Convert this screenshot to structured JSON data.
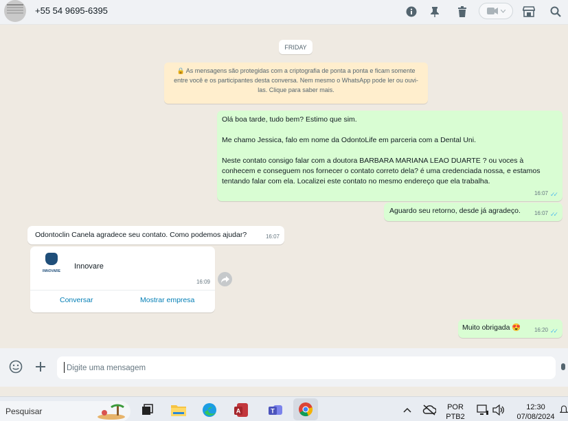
{
  "header": {
    "contact_name": "+55 54 9695-6395"
  },
  "chat": {
    "date_chip": "FRIDAY",
    "encryption_notice": "🔒 As mensagens são protegidas com a criptografia de ponta a ponta e ficam somente entre você e os participantes desta conversa. Nem mesmo o WhatsApp pode ler ou ouvi-las. Clique para saber mais.",
    "messages": [
      {
        "direction": "out",
        "paragraphs": [
          "Olá boa tarde, tudo bem? Estimo que sim.",
          "Me chamo Jessica, falo em nome da OdontoLife em parceria com a Dental Uni.",
          "Neste contato consigo falar com a doutora BARBARA MARIANA LEAO DUARTE ? ou voces à conhecem e conseguem nos fornecer o contato correto dela? é uma credenciada nossa, e estamos tentando falar com ela. Localizei este contato no mesmo endereço que ela trabalha."
        ],
        "time": "16:07"
      },
      {
        "direction": "out",
        "text": "Aguardo seu retorno, desde já agradeço.",
        "time": "16:07"
      },
      {
        "direction": "in",
        "text": "Odontoclin Canela agradece seu contato. Como podemos ajudar?",
        "time": "16:07"
      },
      {
        "direction": "in",
        "card_name": "Innovare",
        "logo_text": "INNOVARE",
        "time": "16:09",
        "button_left": "Conversar",
        "button_right": "Mostrar empresa"
      },
      {
        "direction": "out",
        "text": "Muito obrigada 😍",
        "time": "16:20"
      }
    ]
  },
  "composer": {
    "placeholder": "Digite uma mensagem"
  },
  "taskbar": {
    "search_label": "Pesquisar",
    "language_top": "POR",
    "language_bottom": "PTB2",
    "clock_time": "12:30",
    "clock_date": "07/08/2024"
  },
  "colors": {
    "outgoing_bubble": "#d9fdd3",
    "incoming_bubble": "#ffffff",
    "chat_background": "#efeae2",
    "link_blue": "#027eb5",
    "read_ticks": "#53bdeb"
  }
}
